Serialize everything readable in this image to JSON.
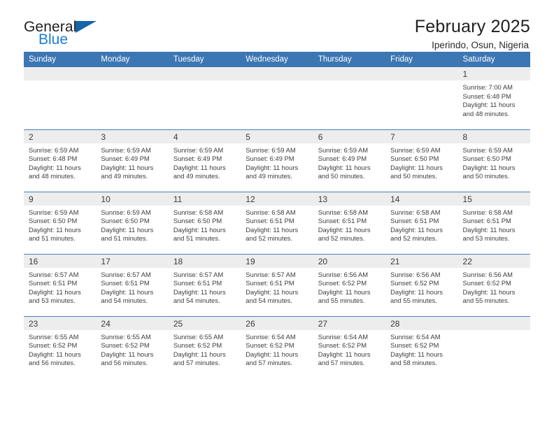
{
  "brand": {
    "name_top": "General",
    "name_bottom": "Blue",
    "accent_color": "#1a7fd4",
    "triangle_color": "#1565a8"
  },
  "header": {
    "title": "February 2025",
    "location": "Iperindo, Osun, Nigeria"
  },
  "theme": {
    "header_row_bg": "#3c77b3",
    "day_number_bg": "#ededed",
    "cell_border": "#4b7fb5",
    "text": "#3d3d3d"
  },
  "weekday_headers": [
    "Sunday",
    "Monday",
    "Tuesday",
    "Wednesday",
    "Thursday",
    "Friday",
    "Saturday"
  ],
  "weeks": [
    [
      {
        "day": "",
        "sunrise": "",
        "sunset": "",
        "daylight_line1": "",
        "daylight_line2": ""
      },
      {
        "day": "",
        "sunrise": "",
        "sunset": "",
        "daylight_line1": "",
        "daylight_line2": ""
      },
      {
        "day": "",
        "sunrise": "",
        "sunset": "",
        "daylight_line1": "",
        "daylight_line2": ""
      },
      {
        "day": "",
        "sunrise": "",
        "sunset": "",
        "daylight_line1": "",
        "daylight_line2": ""
      },
      {
        "day": "",
        "sunrise": "",
        "sunset": "",
        "daylight_line1": "",
        "daylight_line2": ""
      },
      {
        "day": "",
        "sunrise": "",
        "sunset": "",
        "daylight_line1": "",
        "daylight_line2": ""
      },
      {
        "day": "1",
        "sunrise": "Sunrise: 7:00 AM",
        "sunset": "Sunset: 6:48 PM",
        "daylight_line1": "Daylight: 11 hours",
        "daylight_line2": "and 48 minutes."
      }
    ],
    [
      {
        "day": "2",
        "sunrise": "Sunrise: 6:59 AM",
        "sunset": "Sunset: 6:48 PM",
        "daylight_line1": "Daylight: 11 hours",
        "daylight_line2": "and 48 minutes."
      },
      {
        "day": "3",
        "sunrise": "Sunrise: 6:59 AM",
        "sunset": "Sunset: 6:49 PM",
        "daylight_line1": "Daylight: 11 hours",
        "daylight_line2": "and 49 minutes."
      },
      {
        "day": "4",
        "sunrise": "Sunrise: 6:59 AM",
        "sunset": "Sunset: 6:49 PM",
        "daylight_line1": "Daylight: 11 hours",
        "daylight_line2": "and 49 minutes."
      },
      {
        "day": "5",
        "sunrise": "Sunrise: 6:59 AM",
        "sunset": "Sunset: 6:49 PM",
        "daylight_line1": "Daylight: 11 hours",
        "daylight_line2": "and 49 minutes."
      },
      {
        "day": "6",
        "sunrise": "Sunrise: 6:59 AM",
        "sunset": "Sunset: 6:49 PM",
        "daylight_line1": "Daylight: 11 hours",
        "daylight_line2": "and 50 minutes."
      },
      {
        "day": "7",
        "sunrise": "Sunrise: 6:59 AM",
        "sunset": "Sunset: 6:50 PM",
        "daylight_line1": "Daylight: 11 hours",
        "daylight_line2": "and 50 minutes."
      },
      {
        "day": "8",
        "sunrise": "Sunrise: 6:59 AM",
        "sunset": "Sunset: 6:50 PM",
        "daylight_line1": "Daylight: 11 hours",
        "daylight_line2": "and 50 minutes."
      }
    ],
    [
      {
        "day": "9",
        "sunrise": "Sunrise: 6:59 AM",
        "sunset": "Sunset: 6:50 PM",
        "daylight_line1": "Daylight: 11 hours",
        "daylight_line2": "and 51 minutes."
      },
      {
        "day": "10",
        "sunrise": "Sunrise: 6:59 AM",
        "sunset": "Sunset: 6:50 PM",
        "daylight_line1": "Daylight: 11 hours",
        "daylight_line2": "and 51 minutes."
      },
      {
        "day": "11",
        "sunrise": "Sunrise: 6:58 AM",
        "sunset": "Sunset: 6:50 PM",
        "daylight_line1": "Daylight: 11 hours",
        "daylight_line2": "and 51 minutes."
      },
      {
        "day": "12",
        "sunrise": "Sunrise: 6:58 AM",
        "sunset": "Sunset: 6:51 PM",
        "daylight_line1": "Daylight: 11 hours",
        "daylight_line2": "and 52 minutes."
      },
      {
        "day": "13",
        "sunrise": "Sunrise: 6:58 AM",
        "sunset": "Sunset: 6:51 PM",
        "daylight_line1": "Daylight: 11 hours",
        "daylight_line2": "and 52 minutes."
      },
      {
        "day": "14",
        "sunrise": "Sunrise: 6:58 AM",
        "sunset": "Sunset: 6:51 PM",
        "daylight_line1": "Daylight: 11 hours",
        "daylight_line2": "and 52 minutes."
      },
      {
        "day": "15",
        "sunrise": "Sunrise: 6:58 AM",
        "sunset": "Sunset: 6:51 PM",
        "daylight_line1": "Daylight: 11 hours",
        "daylight_line2": "and 53 minutes."
      }
    ],
    [
      {
        "day": "16",
        "sunrise": "Sunrise: 6:57 AM",
        "sunset": "Sunset: 6:51 PM",
        "daylight_line1": "Daylight: 11 hours",
        "daylight_line2": "and 53 minutes."
      },
      {
        "day": "17",
        "sunrise": "Sunrise: 6:57 AM",
        "sunset": "Sunset: 6:51 PM",
        "daylight_line1": "Daylight: 11 hours",
        "daylight_line2": "and 54 minutes."
      },
      {
        "day": "18",
        "sunrise": "Sunrise: 6:57 AM",
        "sunset": "Sunset: 6:51 PM",
        "daylight_line1": "Daylight: 11 hours",
        "daylight_line2": "and 54 minutes."
      },
      {
        "day": "19",
        "sunrise": "Sunrise: 6:57 AM",
        "sunset": "Sunset: 6:51 PM",
        "daylight_line1": "Daylight: 11 hours",
        "daylight_line2": "and 54 minutes."
      },
      {
        "day": "20",
        "sunrise": "Sunrise: 6:56 AM",
        "sunset": "Sunset: 6:52 PM",
        "daylight_line1": "Daylight: 11 hours",
        "daylight_line2": "and 55 minutes."
      },
      {
        "day": "21",
        "sunrise": "Sunrise: 6:56 AM",
        "sunset": "Sunset: 6:52 PM",
        "daylight_line1": "Daylight: 11 hours",
        "daylight_line2": "and 55 minutes."
      },
      {
        "day": "22",
        "sunrise": "Sunrise: 6:56 AM",
        "sunset": "Sunset: 6:52 PM",
        "daylight_line1": "Daylight: 11 hours",
        "daylight_line2": "and 55 minutes."
      }
    ],
    [
      {
        "day": "23",
        "sunrise": "Sunrise: 6:55 AM",
        "sunset": "Sunset: 6:52 PM",
        "daylight_line1": "Daylight: 11 hours",
        "daylight_line2": "and 56 minutes."
      },
      {
        "day": "24",
        "sunrise": "Sunrise: 6:55 AM",
        "sunset": "Sunset: 6:52 PM",
        "daylight_line1": "Daylight: 11 hours",
        "daylight_line2": "and 56 minutes."
      },
      {
        "day": "25",
        "sunrise": "Sunrise: 6:55 AM",
        "sunset": "Sunset: 6:52 PM",
        "daylight_line1": "Daylight: 11 hours",
        "daylight_line2": "and 57 minutes."
      },
      {
        "day": "26",
        "sunrise": "Sunrise: 6:54 AM",
        "sunset": "Sunset: 6:52 PM",
        "daylight_line1": "Daylight: 11 hours",
        "daylight_line2": "and 57 minutes."
      },
      {
        "day": "27",
        "sunrise": "Sunrise: 6:54 AM",
        "sunset": "Sunset: 6:52 PM",
        "daylight_line1": "Daylight: 11 hours",
        "daylight_line2": "and 57 minutes."
      },
      {
        "day": "28",
        "sunrise": "Sunrise: 6:54 AM",
        "sunset": "Sunset: 6:52 PM",
        "daylight_line1": "Daylight: 11 hours",
        "daylight_line2": "and 58 minutes."
      },
      {
        "day": "",
        "sunrise": "",
        "sunset": "",
        "daylight_line1": "",
        "daylight_line2": ""
      }
    ]
  ]
}
